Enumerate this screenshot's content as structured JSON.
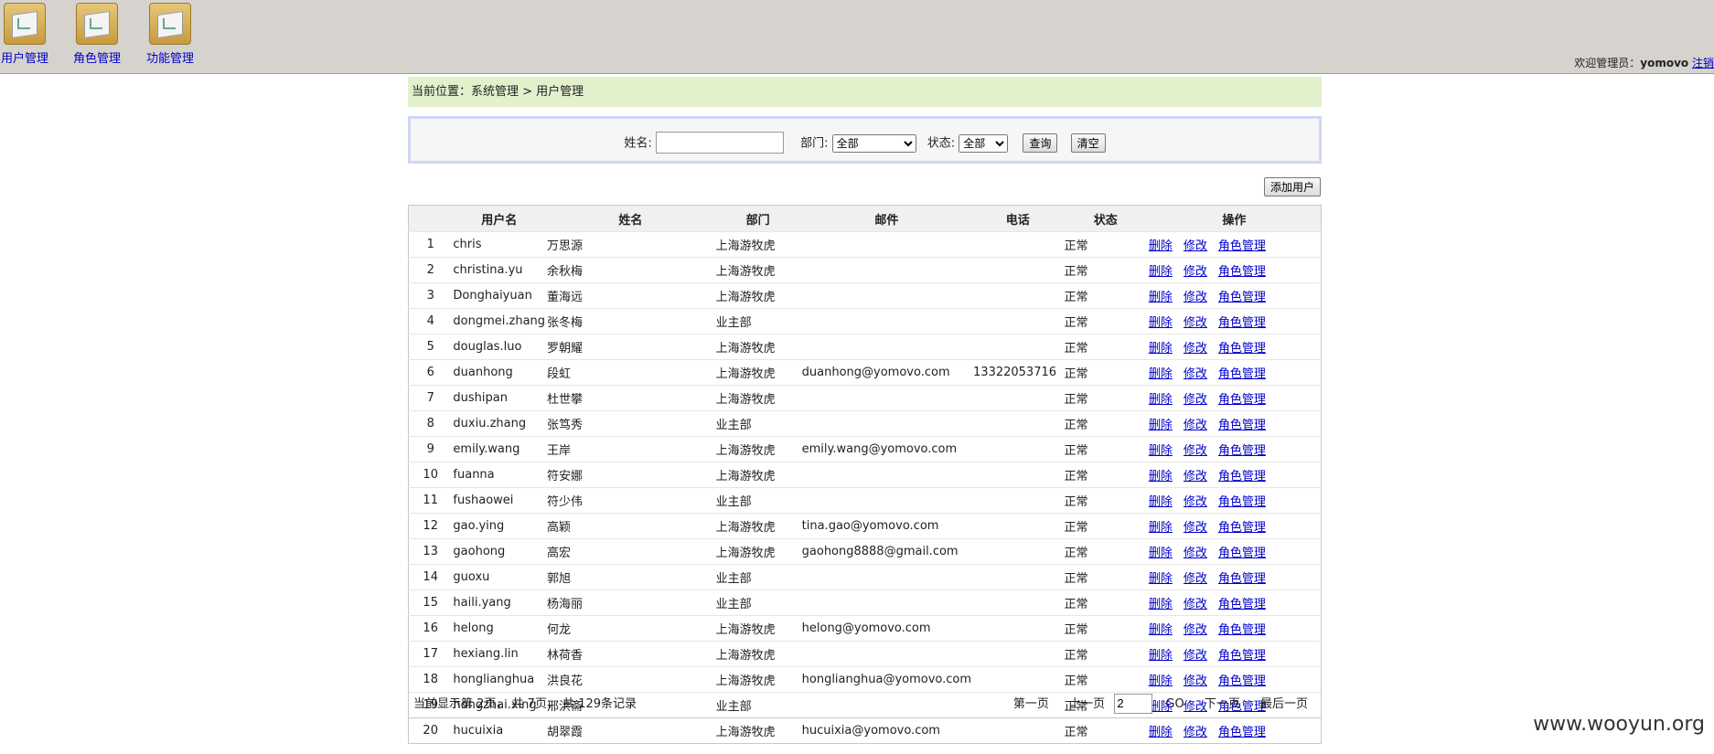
{
  "nav": [
    {
      "label": "用户管理",
      "icon": "folder-chart-icon"
    },
    {
      "label": "角色管理",
      "icon": "folder-chart-icon"
    },
    {
      "label": "功能管理",
      "icon": "folder-chart-icon"
    }
  ],
  "welcome": {
    "prefix": "欢迎管理员：",
    "user": "yomovo",
    "logout": "注销"
  },
  "breadcrumb": "当前位置：系统管理 > 用户管理",
  "filter": {
    "name_label": "姓名:",
    "name_value": "",
    "dept_label": "部门:",
    "dept_value": "全部",
    "status_label": "状态:",
    "status_value": "全部",
    "search_btn": "查询",
    "clear_btn": "清空"
  },
  "add_user": "添加用户",
  "table": {
    "headers": [
      "",
      "用户名",
      "姓名",
      "部门",
      "邮件",
      "电话",
      "状态",
      "操作"
    ],
    "actions": {
      "delete": "删除",
      "edit": "修改",
      "role": "角色管理"
    },
    "rows": [
      {
        "no": "1",
        "user": "chris",
        "name": "万思源",
        "dept": "上海游牧虎",
        "email": "",
        "phone": "",
        "status": "正常"
      },
      {
        "no": "2",
        "user": "christina.yu",
        "name": "余秋梅",
        "dept": "上海游牧虎",
        "email": "",
        "phone": "",
        "status": "正常"
      },
      {
        "no": "3",
        "user": "Donghaiyuan",
        "name": "董海远",
        "dept": "上海游牧虎",
        "email": "",
        "phone": "",
        "status": "正常"
      },
      {
        "no": "4",
        "user": "dongmei.zhang",
        "name": "张冬梅",
        "dept": "业主部",
        "email": "",
        "phone": "",
        "status": "正常"
      },
      {
        "no": "5",
        "user": "douglas.luo",
        "name": "罗朝耀",
        "dept": "上海游牧虎",
        "email": "",
        "phone": "",
        "status": "正常"
      },
      {
        "no": "6",
        "user": "duanhong",
        "name": "段虹",
        "dept": "上海游牧虎",
        "email": "duanhong@yomovo.com",
        "phone": "13322053716",
        "status": "正常"
      },
      {
        "no": "7",
        "user": "dushipan",
        "name": "杜世攀",
        "dept": "上海游牧虎",
        "email": "",
        "phone": "",
        "status": "正常"
      },
      {
        "no": "8",
        "user": "duxiu.zhang",
        "name": "张笃秀",
        "dept": "业主部",
        "email": "",
        "phone": "",
        "status": "正常"
      },
      {
        "no": "9",
        "user": "emily.wang",
        "name": "王岸",
        "dept": "上海游牧虎",
        "email": "emily.wang@yomovo.com",
        "phone": "",
        "status": "正常"
      },
      {
        "no": "10",
        "user": "fuanna",
        "name": "符安娜",
        "dept": "上海游牧虎",
        "email": "",
        "phone": "",
        "status": "正常"
      },
      {
        "no": "11",
        "user": "fushaowei",
        "name": "符少伟",
        "dept": "业主部",
        "email": "",
        "phone": "",
        "status": "正常"
      },
      {
        "no": "12",
        "user": "gao.ying",
        "name": "高颖",
        "dept": "上海游牧虎",
        "email": "tina.gao@yomovo.com",
        "phone": "",
        "status": "正常"
      },
      {
        "no": "13",
        "user": "gaohong",
        "name": "高宏",
        "dept": "上海游牧虎",
        "email": "gaohong8888@gmail.com",
        "phone": "",
        "status": "正常"
      },
      {
        "no": "14",
        "user": "guoxu",
        "name": "郭旭",
        "dept": "业主部",
        "email": "",
        "phone": "",
        "status": "正常"
      },
      {
        "no": "15",
        "user": "haili.yang",
        "name": "杨海丽",
        "dept": "业主部",
        "email": "",
        "phone": "",
        "status": "正常"
      },
      {
        "no": "16",
        "user": "helong",
        "name": "何龙",
        "dept": "上海游牧虎",
        "email": "helong@yomovo.com",
        "phone": "",
        "status": "正常"
      },
      {
        "no": "17",
        "user": "hexiang.lin",
        "name": "林荷香",
        "dept": "上海游牧虎",
        "email": "",
        "phone": "",
        "status": "正常"
      },
      {
        "no": "18",
        "user": "honglianghua",
        "name": "洪良花",
        "dept": "上海游牧虎",
        "email": "honglianghua@yomovo.com",
        "phone": "",
        "status": "正常"
      },
      {
        "no": "19",
        "user": "hongzhai.xing",
        "name": "邢洪斋",
        "dept": "业主部",
        "email": "",
        "phone": "",
        "status": "正常"
      },
      {
        "no": "20",
        "user": "hucuixia",
        "name": "胡翠霞",
        "dept": "上海游牧虎",
        "email": "hucuixia@yomovo.com",
        "phone": "",
        "status": "正常"
      }
    ]
  },
  "pager": {
    "summary": "当前显示第 2页， 共 7页， 共 129条记录",
    "first": "第一页",
    "prev": "上一页",
    "page_value": "2",
    "go": "GO",
    "next": "下一页",
    "last": "最后一页"
  },
  "watermark": "www.wooyun.org"
}
